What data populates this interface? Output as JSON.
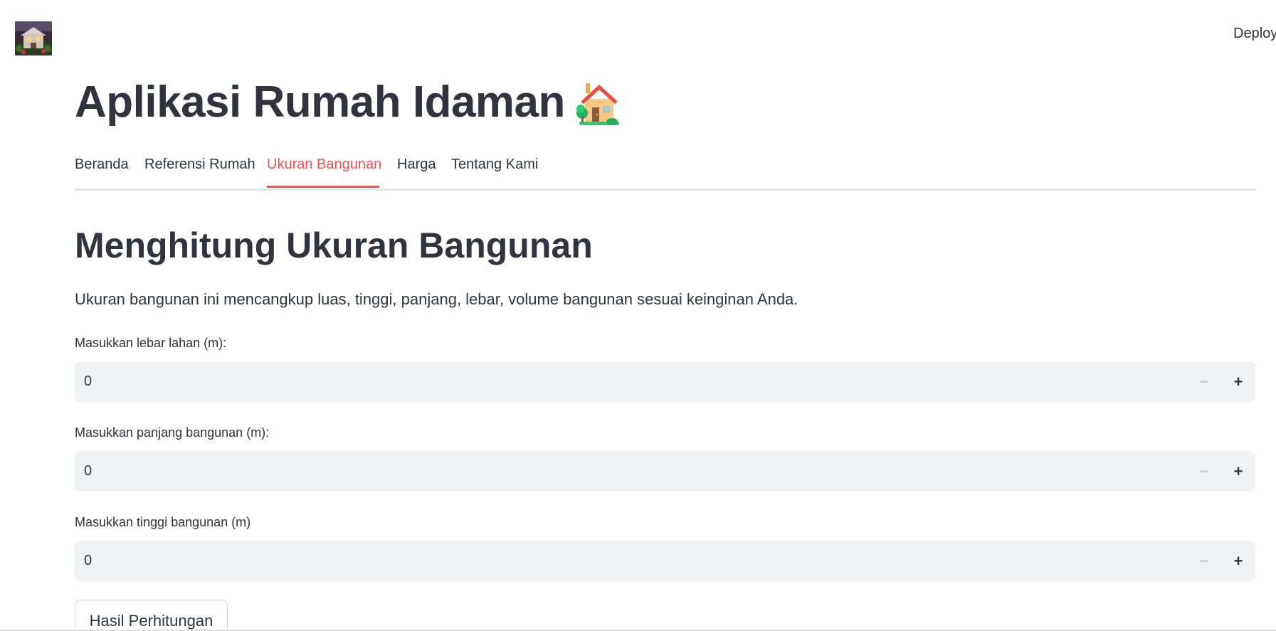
{
  "header": {
    "deploy_label": "Deploy"
  },
  "app": {
    "title": "Aplikasi Rumah Idaman",
    "title_emoji_icon": "house-with-garden-icon"
  },
  "tabs": [
    {
      "label": "Beranda",
      "active": false
    },
    {
      "label": "Referensi Rumah",
      "active": false
    },
    {
      "label": "Ukuran Bangunan",
      "active": true
    },
    {
      "label": "Harga",
      "active": false
    },
    {
      "label": "Tentang Kami",
      "active": false
    }
  ],
  "section": {
    "heading": "Menghitung Ukuran Bangunan",
    "description": "Ukuran bangunan ini mencangkup luas, tinggi, panjang, lebar, volume bangunan sesuai keinginan Anda."
  },
  "inputs": [
    {
      "label": "Masukkan lebar lahan (m):",
      "value": "0"
    },
    {
      "label": "Masukkan panjang bangunan (m):",
      "value": "0"
    },
    {
      "label": "Masukkan tinggi bangunan (m)",
      "value": "0"
    }
  ],
  "stepper": {
    "minus_symbol": "−",
    "plus_symbol": "+"
  },
  "actions": {
    "calculate_label": "Hasil Perhitungan"
  },
  "colors": {
    "accent": "#ff4b4b",
    "text": "#31333f",
    "input_bg": "#f0f2f6"
  }
}
